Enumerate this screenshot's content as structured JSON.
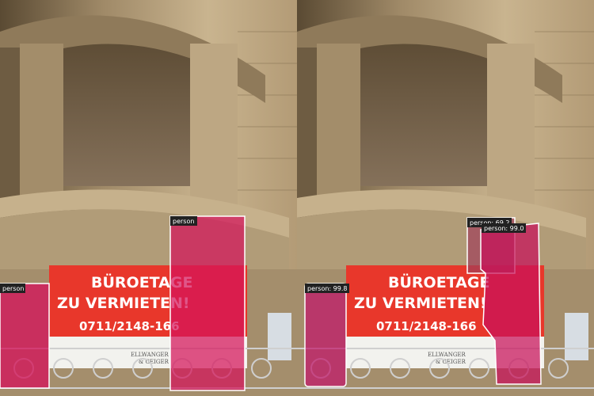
{
  "sign": {
    "line1": "BÜROETAGE",
    "line2": "ZU VERMIETEN!",
    "phone": "0711/2148-166",
    "company_top": "ELLWANGER",
    "company_bottom": "& GEIGER"
  },
  "panels": [
    {
      "name": "left",
      "detections": [
        {
          "label": "person",
          "color": "#d4145a"
        },
        {
          "label": "person",
          "color": "#d4145a"
        }
      ]
    },
    {
      "name": "right",
      "detections": [
        {
          "label": "person: 99.8",
          "color": "#c0166a"
        },
        {
          "label": "person: 69.2",
          "color": "#c0166a"
        },
        {
          "label": "person: 99.0",
          "color": "#c0166a"
        }
      ]
    }
  ]
}
